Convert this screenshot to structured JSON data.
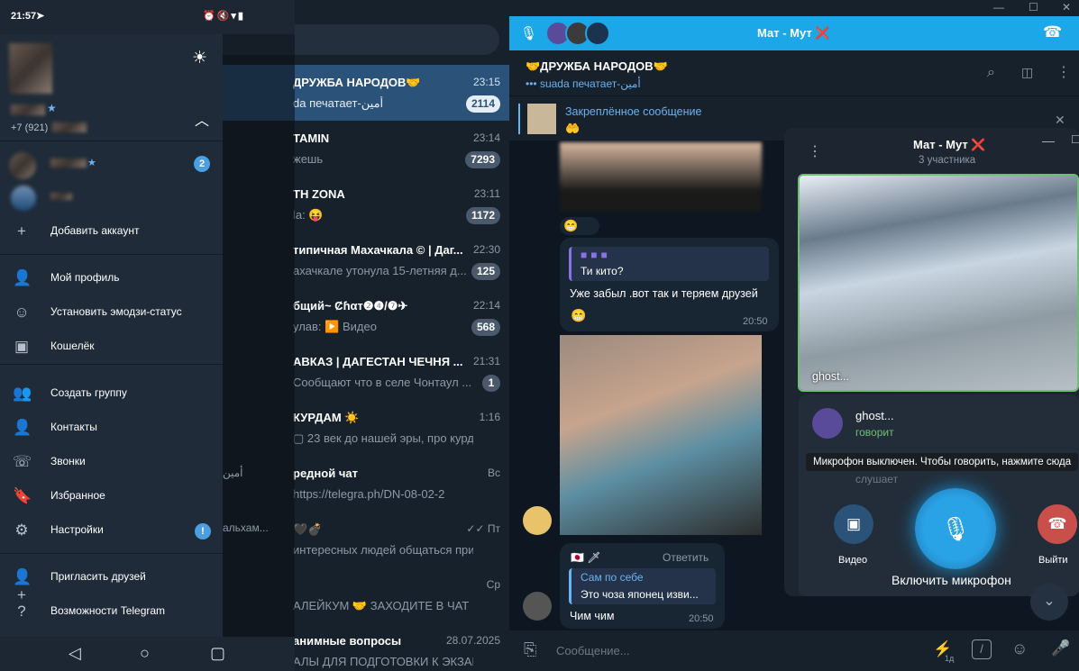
{
  "colors": {
    "accent": "#1ba7e8",
    "drawer": "#1f2b38",
    "chatlist": "#17212b",
    "active_row": "#2b5278",
    "speaking": "#6fbf73",
    "leave": "#c9504a"
  },
  "phone": {
    "time": "21:57"
  },
  "drawer": {
    "account_phone": "+7 (921)",
    "accounts": [
      {
        "badge": "2"
      }
    ],
    "add_account": "Добавить аккаунт",
    "menu": [
      "Мой профиль",
      "Установить эмодзи-статус",
      "Кошелёк",
      "Создать группу",
      "Контакты",
      "Звонки",
      "Избранное",
      "Настройки",
      "Пригласить друзей",
      "Возможности Telegram"
    ],
    "settings_badge": "!"
  },
  "chats": [
    {
      "title": "ДРУЖБА НАРОДОВ🤝",
      "time": "23:15",
      "msg": "da печатает-أمين",
      "badge": "2114",
      "active": true
    },
    {
      "title": "TAMIN",
      "time": "23:14",
      "msg": "жешь",
      "badge": "7293"
    },
    {
      "title": "TH ZONA",
      "time": "23:11",
      "msg": "la: 😝",
      "badge": "1172"
    },
    {
      "title": "типичная Махачкала © | Даг...",
      "time": "22:30",
      "msg": "ахачкале утонула 15-летняя д...",
      "badge": "125"
    },
    {
      "title": "бщий~ Ȼɦαт❷❹/❼✈",
      "time": "22:14",
      "msg": "улав: ▶️ Видео",
      "badge": "568"
    },
    {
      "title": "АВКАЗ | ДАГЕСТАН ЧЕЧНЯ ...",
      "time": "21:31",
      "msg": "Сообщают что в селе Чонтаул ...",
      "badge": "1"
    },
    {
      "title": "КУРДАМ ☀️",
      "time": "1:16",
      "msg": "▢ 23 век до нашей эры, про курдов ...",
      "badge": ""
    },
    {
      "title": "редной чат",
      "time": "Вс",
      "msg": "https://telegra.ph/DN-08-02-2",
      "badge": ""
    },
    {
      "title": "🖤💣",
      "time": "✓✓ Пт",
      "msg": "интересных людей общаться приг...",
      "badge": ""
    },
    {
      "title": "",
      "time": "Ср",
      "msg": "АЛЕЙКУМ 🤝 ЗАХОДИТЕ В ЧАТ ...",
      "badge": ""
    },
    {
      "title": "анимные вопросы",
      "time": "28.07.2025",
      "msg": "АЛЫ ДЛЯ ПОДГОТОВКИ К ЭКЗАМЕ...",
      "badge": ""
    }
  ],
  "behind_text": {
    "amin": "أمين",
    "alham": "альхам..."
  },
  "call": {
    "title": "Мат - Мут ❌",
    "participants": "3 участника",
    "speaker_name": "ghost...",
    "speaker_status": "говорит",
    "video_label": "ghost...",
    "listener_status": "слушает",
    "tooltip": "Микрофон выключен. Чтобы говорить, нажмите сюда",
    "video_btn": "Видео",
    "mic_btn": "Включить микрофон",
    "leave_btn": "Выйти"
  },
  "chat": {
    "title": "🤝ДРУЖБА НАРОДОВ🤝",
    "typing": "••• suada печатает-أمين",
    "pinned_title": "Закреплённое сообщение",
    "pinned_text": "🤲",
    "msg1": {
      "reply_text": "Ти кито?",
      "text": "Уже забыл .вот так и теряем друзей",
      "time": "20:50"
    },
    "msg2": {
      "author": "🇯🇵 🗡",
      "reply_action": "Ответить",
      "reply_name": "Сам по себе",
      "reply_text": "Это чоза японец изви...",
      "text": "Чим чим",
      "time": "20:50"
    },
    "input_placeholder": "Сообщение...",
    "sticker_count": "1д"
  }
}
